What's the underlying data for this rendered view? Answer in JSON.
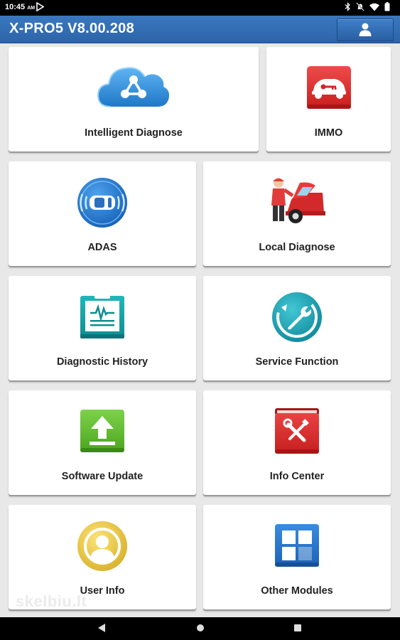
{
  "status": {
    "time": "10:45",
    "ampm": "AM",
    "icons": [
      "play-store-icon",
      "bluetooth-icon",
      "mute-icon",
      "wifi-icon",
      "battery-icon"
    ]
  },
  "header": {
    "title": "X-PRO5 V8.00.208",
    "user_icon": "user-icon"
  },
  "tiles": [
    {
      "label": "Intelligent Diagnose",
      "icon": "cloud-share-icon"
    },
    {
      "label": "IMMO",
      "icon": "car-key-icon"
    },
    {
      "label": "ADAS",
      "icon": "car-radar-icon"
    },
    {
      "label": "Local Diagnose",
      "icon": "mechanic-car-icon"
    },
    {
      "label": "Diagnostic History",
      "icon": "clipboard-waveform-icon"
    },
    {
      "label": "Service Function",
      "icon": "wrench-refresh-icon"
    },
    {
      "label": "Software Update",
      "icon": "upload-icon"
    },
    {
      "label": "Info Center",
      "icon": "tools-book-icon"
    },
    {
      "label": "User Info",
      "icon": "user-circle-icon"
    },
    {
      "label": "Other Modules",
      "icon": "grid-modules-icon"
    }
  ],
  "watermark": "skelbiu.lt",
  "navigation": {
    "back": "back-icon",
    "home": "home-icon",
    "recents": "recents-icon"
  },
  "colors": {
    "appbar": "#2f6aaf",
    "background": "#e8e8e8",
    "tile": "#ffffff"
  }
}
